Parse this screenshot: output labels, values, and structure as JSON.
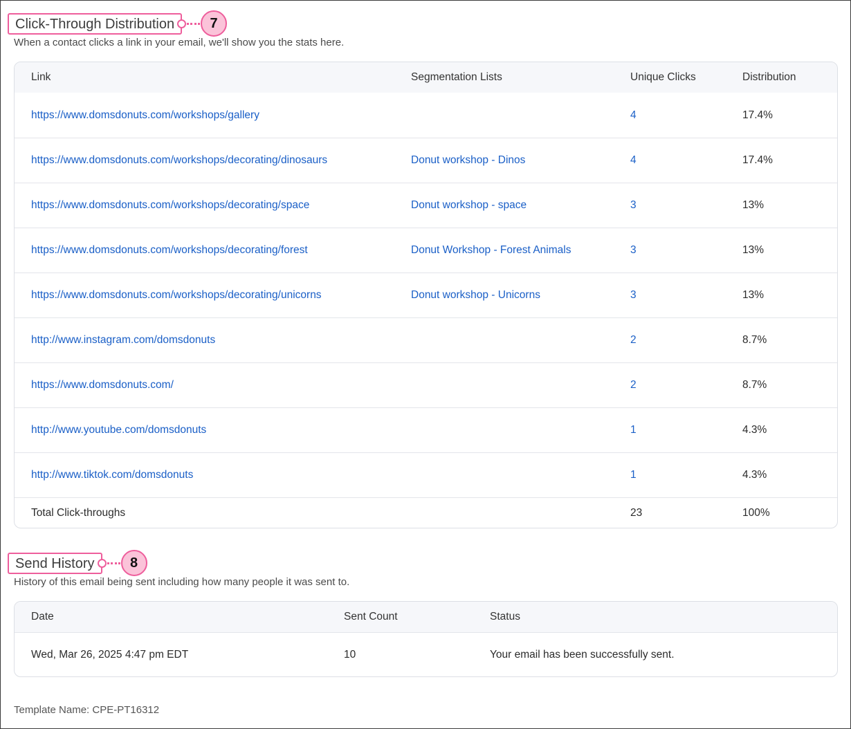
{
  "click_section": {
    "title": "Click-Through Distribution",
    "badge": "7",
    "description": "When a contact clicks a link in your email, we'll show you the stats here.",
    "columns": [
      "Link",
      "Segmentation Lists",
      "Unique Clicks",
      "Distribution"
    ],
    "rows": [
      {
        "link": "https://www.domsdonuts.com/workshops/gallery",
        "segment": "",
        "clicks": "4",
        "distribution": "17.4%"
      },
      {
        "link": "https://www.domsdonuts.com/workshops/decorating/dinosaurs",
        "segment": "Donut workshop - Dinos",
        "clicks": "4",
        "distribution": "17.4%"
      },
      {
        "link": "https://www.domsdonuts.com/workshops/decorating/space",
        "segment": "Donut workshop - space",
        "clicks": "3",
        "distribution": "13%"
      },
      {
        "link": "https://www.domsdonuts.com/workshops/decorating/forest",
        "segment": "Donut Workshop - Forest Animals",
        "clicks": "3",
        "distribution": "13%"
      },
      {
        "link": "https://www.domsdonuts.com/workshops/decorating/unicorns",
        "segment": "Donut workshop - Unicorns",
        "clicks": "3",
        "distribution": "13%"
      },
      {
        "link": "http://www.instagram.com/domsdonuts",
        "segment": "",
        "clicks": "2",
        "distribution": "8.7%"
      },
      {
        "link": "https://www.domsdonuts.com/",
        "segment": "",
        "clicks": "2",
        "distribution": "8.7%"
      },
      {
        "link": "http://www.youtube.com/domsdonuts",
        "segment": "",
        "clicks": "1",
        "distribution": "4.3%"
      },
      {
        "link": "http://www.tiktok.com/domsdonuts",
        "segment": "",
        "clicks": "1",
        "distribution": "4.3%"
      }
    ],
    "total": {
      "label": "Total Click-throughs",
      "clicks": "23",
      "distribution": "100%"
    }
  },
  "send_section": {
    "title": "Send History",
    "badge": "8",
    "description": "History of this email being sent including how many people it was sent to.",
    "columns": [
      "Date",
      "Sent Count",
      "Status"
    ],
    "rows": [
      {
        "date": "Wed, Mar 26, 2025 4:47 pm EDT",
        "count": "10",
        "status": "Your email has been successfully sent."
      }
    ]
  },
  "footer": {
    "template_name": "Template Name: CPE-PT16312"
  },
  "colors": {
    "callout": "#ee5e9c",
    "badge_fill": "#fbc3d9",
    "link": "#1a5fc7"
  }
}
